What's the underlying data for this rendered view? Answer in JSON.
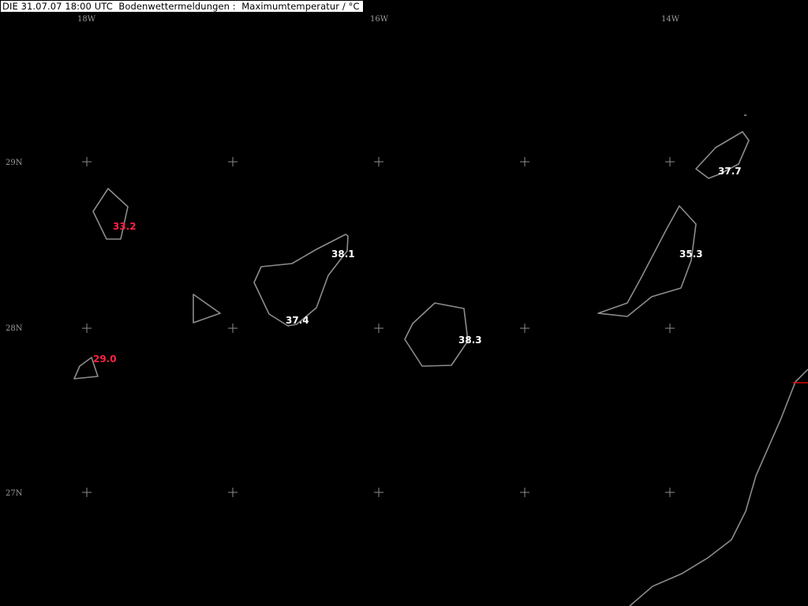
{
  "map": {
    "title": "DIE 31.07.07 18:00 UTC  Bodenwettermeldungen :  Maximumtemperatur / °C",
    "longitude_labels": [
      "18W",
      "16W",
      "14W"
    ],
    "latitude_labels": [
      "29N",
      "28N",
      "27N"
    ],
    "colors": {
      "background": "#000000",
      "coastline": "#8c8c8c",
      "grid": "#8c8c8c",
      "value_normal": "#ffffff",
      "value_low": "#ff2244",
      "border": "#e00000"
    },
    "stations": [
      {
        "value": "33.2",
        "color": "#ff2244"
      },
      {
        "value": "29.0",
        "color": "#ff2244"
      },
      {
        "value": "38.1",
        "color": "#ffffff"
      },
      {
        "value": "37.4",
        "color": "#ffffff"
      },
      {
        "value": "38.3",
        "color": "#ffffff"
      },
      {
        "value": "35.3",
        "color": "#ffffff"
      },
      {
        "value": "37.7",
        "color": "#ffffff"
      }
    ]
  }
}
